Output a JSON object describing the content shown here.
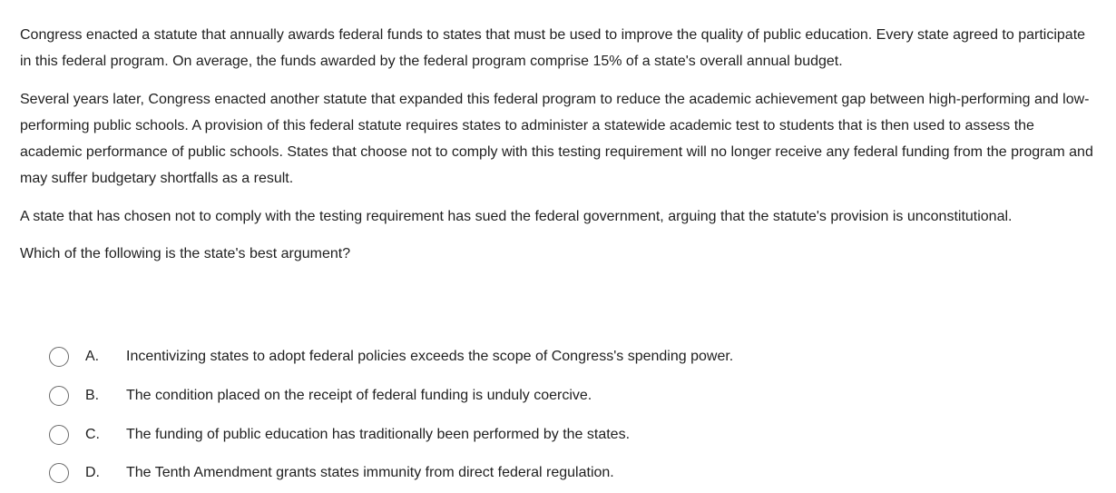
{
  "question": {
    "paragraphs": [
      "Congress enacted a statute that annually awards federal funds to states that must be used to improve the quality of public education.  Every state agreed to participate in this federal program.  On average, the funds awarded by the federal program comprise 15% of a state's overall annual budget.",
      "Several years later, Congress enacted another statute that expanded this federal program to reduce the academic achievement gap between high-performing and low-performing public schools.  A provision of this federal statute requires states to administer a statewide academic test to students that is then used to assess the academic performance of public schools.  States that choose not to comply with this testing requirement will no longer receive any federal funding from the program and may suffer budgetary shortfalls as a result.",
      "A state that has chosen not to comply with the testing requirement has sued the federal government, arguing that the statute's provision is unconstitutional."
    ],
    "prompt": "Which of the following is the state's best argument?"
  },
  "choices": [
    {
      "letter": "A.",
      "text": "Incentivizing states to adopt federal policies exceeds the scope of Congress's spending power."
    },
    {
      "letter": "B.",
      "text": "The condition placed on the receipt of federal funding is unduly coercive."
    },
    {
      "letter": "C.",
      "text": "The funding of public education has traditionally been performed by the states."
    },
    {
      "letter": "D.",
      "text": "The Tenth Amendment grants states immunity from direct federal regulation."
    }
  ]
}
